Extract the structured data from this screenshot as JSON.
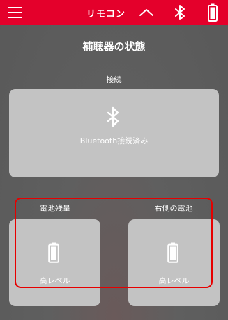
{
  "header": {
    "title": "リモコン",
    "background_color": "#e4002b",
    "menu_icon": "hamburger-menu-icon",
    "collapse_icon": "chevron-up-icon",
    "bluetooth_icon": "bluetooth-icon",
    "battery_icon": "battery-full-icon"
  },
  "page": {
    "title": "補聴器の状態"
  },
  "connection": {
    "label": "接続",
    "icon": "bluetooth-icon",
    "status": "Bluetooth接続済み"
  },
  "battery": {
    "left": {
      "label": "電池残量",
      "icon": "battery-full-icon",
      "level": "高レベル"
    },
    "right": {
      "label": "右側の電池",
      "icon": "battery-full-icon",
      "level": "高レベル"
    }
  },
  "colors": {
    "accent": "#e4002b",
    "card": "#c3c3c3",
    "highlight": "#e60000"
  }
}
